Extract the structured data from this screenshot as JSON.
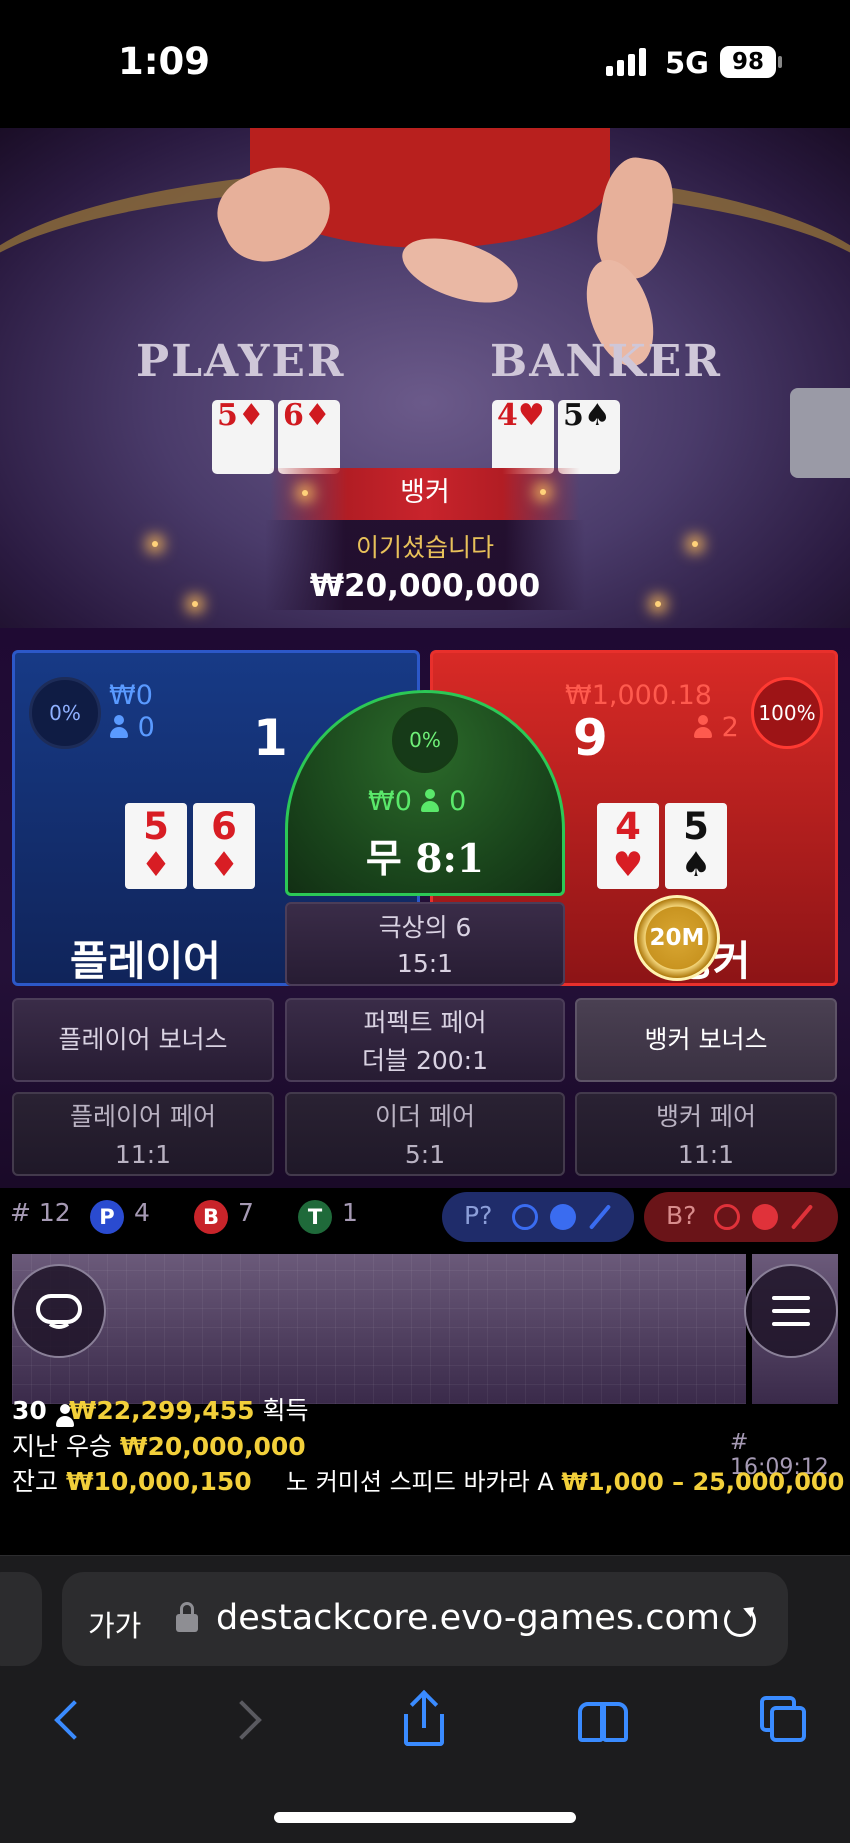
{
  "status_bar": {
    "time": "1:09",
    "network": "5G",
    "battery": "98"
  },
  "video": {
    "felt_player": "PLAYER",
    "felt_banker": "BANKER",
    "player_cards": [
      {
        "rank": "5",
        "suit": "♦"
      },
      {
        "rank": "6",
        "suit": "♦"
      }
    ],
    "banker_cards": [
      {
        "rank": "4",
        "suit": "♥"
      },
      {
        "rank": "5",
        "suit": "♠"
      }
    ],
    "result_banner": "뱅커",
    "result_title": "이기셨습니다",
    "result_amount": "₩20,000,000"
  },
  "player": {
    "percent": "0%",
    "amount": "₩0",
    "players": "0",
    "score": "1",
    "cards": [
      {
        "rank": "5",
        "suit": "♦"
      },
      {
        "rank": "6",
        "suit": "♦"
      }
    ],
    "title": "플레이어"
  },
  "tie": {
    "percent": "0%",
    "amount": "₩0",
    "players": "0",
    "label": "무 8:1"
  },
  "banker": {
    "percent": "100%",
    "amount": "₩1,000.18",
    "players": "2",
    "score": "9",
    "cards": [
      {
        "rank": "4",
        "suit": "♥"
      },
      {
        "rank": "5",
        "suit": "♠"
      }
    ],
    "title": "뱅커",
    "chip": "20M"
  },
  "side_bets": {
    "super6": {
      "name": "극상의 6",
      "odds": "15:1"
    },
    "player_bonus": {
      "name": "플레이어 보너스"
    },
    "perfect_pair": {
      "name": "퍼펙트 페어",
      "odds": "더블 200:1"
    },
    "banker_bonus": {
      "name": "뱅커 보너스"
    },
    "player_pair": {
      "name": "플레이어 페어",
      "odds": "11:1"
    },
    "either_pair": {
      "name": "이더 페어",
      "odds": "5:1"
    },
    "banker_pair": {
      "name": "뱅커 페어",
      "odds": "11:1"
    }
  },
  "counts": {
    "round": "# 12",
    "p_letter": "P",
    "p_count": "4",
    "b_letter": "B",
    "b_count": "7",
    "t_letter": "T",
    "t_count": "1",
    "p_predict": "P?",
    "b_predict": "B?"
  },
  "info": {
    "winners_count": "30",
    "winners_amount": "₩22,299,455",
    "winners_suffix": "획득",
    "last_win_label": "지난 우승",
    "last_win_amount": "₩20,000,000",
    "round_id": "# 16:09:12",
    "balance_label": "잔고",
    "balance_amount": "₩10,000,150",
    "table_name": "노 커미션 스피드 바카라 A",
    "limits": "₩1,000 – 25,000,000"
  },
  "browser": {
    "text_size": "가가",
    "url": "destackcore.evo-games.com"
  },
  "colors": {
    "player": "#1a3f8f",
    "banker": "#d42a26",
    "tie": "#1f5a22",
    "gold": "#f2cf3a"
  }
}
